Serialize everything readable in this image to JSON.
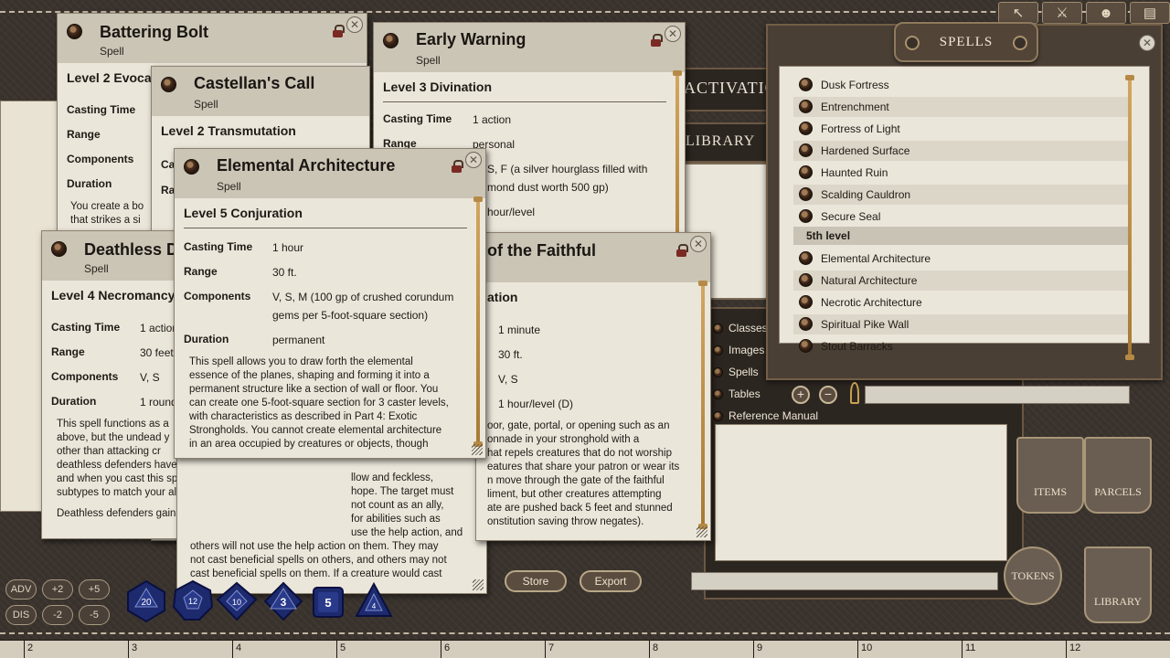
{
  "toolbar": {
    "tools": [
      {
        "icon": "pointer-icon",
        "glyph": "↖"
      },
      {
        "icon": "swords-icon",
        "glyph": "⚔"
      },
      {
        "icon": "party-icon",
        "glyph": "☻"
      },
      {
        "icon": "map-icon",
        "glyph": "▤"
      }
    ]
  },
  "background": {
    "activation_label": "ACTIVATIO",
    "library_label": "LIBRARY",
    "library_items": [
      "Classes",
      "Images",
      "Spells",
      "Tables",
      "Reference Manual"
    ],
    "side_buttons": {
      "items": "ITEMS",
      "parcels": "PARCELS",
      "tokens": "TOKENS",
      "library": "LIBRARY"
    }
  },
  "windows": {
    "battering_bolt": {
      "title": "Battering Bolt",
      "type": "Spell",
      "level": "Level 2 Evocati",
      "labels": [
        "Casting Time",
        "Range",
        "Components",
        "Duration"
      ],
      "desc": "You create a bo\nthat strikes a si"
    },
    "castellans_call": {
      "title": "Castellan's Call",
      "type": "Spell",
      "level": "Level 2 Transmutation",
      "labels": [
        "Cas",
        "Ra"
      ]
    },
    "early_warning": {
      "title": "Early Warning",
      "type": "Spell",
      "level": "Level 3 Divination",
      "labels": [
        "Casting Time",
        "Range"
      ],
      "values": [
        "1 action",
        "personal",
        "S, F (a silver hourglass filled with",
        "mond dust worth 500 gp)",
        "hour/level"
      ]
    },
    "deathless": {
      "title": "Deathless De",
      "type": "Spell",
      "level": "Level 4 Necromancy",
      "labels": [
        "Casting Time",
        "Range",
        "Components",
        "Duration"
      ],
      "values": [
        "1 action",
        "30 feet",
        "V, S",
        "1 round"
      ],
      "desc_lines": [
        "This spell functions as a",
        "above, but the undead y",
        "other than attacking cr",
        "deathless defenders have the same alignment you do,",
        "and when you cast this spell the spell gains alignment",
        "subtypes to match your alignment.",
        "",
        "Deathless defenders gain advantage on any saving"
      ]
    },
    "gate_faithful": {
      "title": "of the Faithful",
      "level": "ation",
      "values": [
        "1 minute",
        "30 ft.",
        "V, S",
        "1 hour/level (D)"
      ],
      "desc_lines": [
        "oor, gate, portal, or opening such as an",
        "onnade in your stronghold with a",
        "hat repels creatures that do not worship",
        "eatures that share your patron or wear its",
        "n move through the gate of the faithful",
        "liment, but other creatures attempting",
        "ate are pushed back 5 feet and stunned",
        "onstitution saving throw negates)."
      ]
    },
    "castellan_desc": {
      "desc_lines": [
        "llow and feckless,",
        "hope. The target must",
        "not count as an ally,",
        "for abilities such as",
        "use the help action, and",
        "others will not use the help action on them. They may",
        "not cast beneficial spells on others, and others may not",
        "cast beneficial spells on them. If a creature would cast"
      ]
    },
    "elemental": {
      "title": "Elemental Architecture",
      "type": "Spell",
      "level": "Level 5 Conjuration",
      "labels": [
        "Casting Time",
        "Range",
        "Components",
        "Duration"
      ],
      "values": [
        "1 hour",
        "30 ft.",
        "V, S, M (100 gp of crushed corundum",
        "gems per 5-foot-square section)",
        "permanent"
      ],
      "desc_lines": [
        "This spell allows you to draw forth the elemental",
        "essence of the planes, shaping and forming it into a",
        "permanent structure like a section of wall or floor. You",
        "can create one 5-foot-square section for 3 caster levels,",
        "with characteristics as described in Part 4: Exotic",
        "Strongholds. You cannot create elemental architecture",
        "in an area occupied by creatures or objects, though"
      ]
    }
  },
  "spells_panel": {
    "title": "SPELLS",
    "items_top": [
      "Dusk Fortress",
      "Entrenchment",
      "Fortress of Light",
      "Hardened Surface",
      "Haunted Ruin",
      "Scalding Cauldron",
      "Secure Seal"
    ],
    "group_label": "5th level",
    "items_5th": [
      "Elemental Architecture",
      "Natural Architecture",
      "Necrotic Architecture",
      "Spiritual Pike Wall",
      "Stout Barracks"
    ],
    "search_value": ""
  },
  "library_actions": {
    "store": "Store",
    "export": "Export",
    "search_value": ""
  },
  "modifiers": {
    "adv": "ADV",
    "dis": "DIS",
    "p2": "+2",
    "p5": "+5",
    "m2": "-2",
    "m5": "-5"
  },
  "dice": [
    {
      "name": "d20",
      "label": "20"
    },
    {
      "name": "d12",
      "label": "12"
    },
    {
      "name": "d10",
      "label": "10"
    },
    {
      "name": "d8",
      "label": "3"
    },
    {
      "name": "d6",
      "label": "5"
    },
    {
      "name": "d4",
      "label": "4"
    }
  ],
  "ruler": [
    "2",
    "3",
    "4",
    "5",
    "6",
    "7",
    "8",
    "9",
    "10",
    "11",
    "12"
  ],
  "colors": {
    "parchment": "#ebe6da",
    "header": "#cbc5b6",
    "leather": "#3a332d",
    "accent_brass": "#c89a52",
    "dice_blue": "#1d2a6e"
  }
}
